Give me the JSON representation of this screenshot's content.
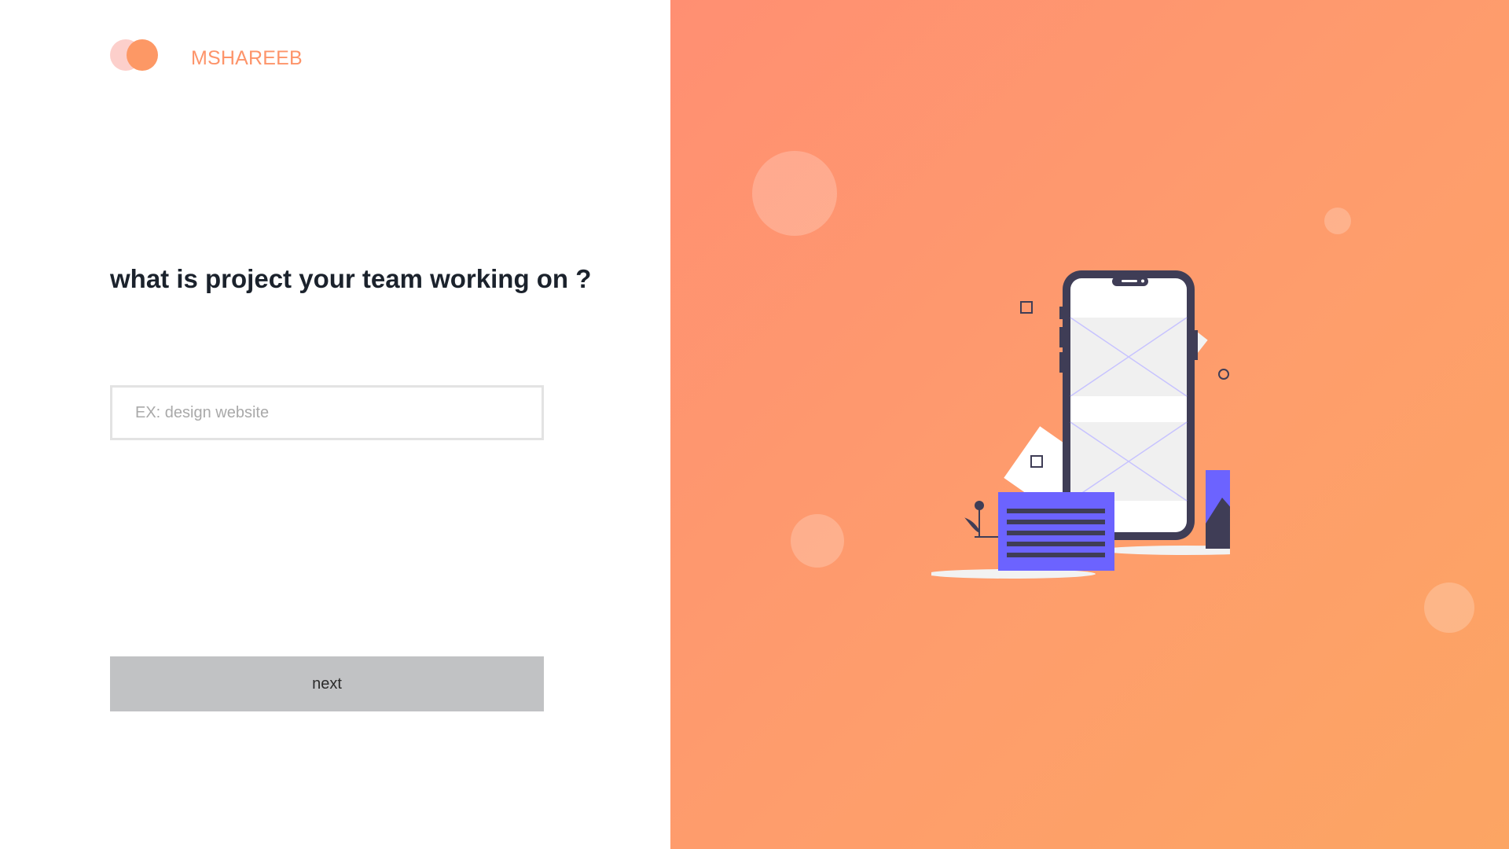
{
  "brand": {
    "name": "MSHAREEB"
  },
  "form": {
    "question": "what is project your team working on ?",
    "input_placeholder": "EX: design website",
    "input_value": "",
    "next_label": "next"
  },
  "colors": {
    "brand_text": "#fd946a",
    "logo_back": "#fccfcb",
    "logo_front": "#fd9865",
    "heading": "#1b222c",
    "button_bg": "#c1c2c4",
    "gradient_start": "#ff8f72",
    "gradient_end": "#fca563",
    "illustration_accent": "#6c63ff",
    "illustration_dark": "#3f3d56"
  },
  "icons": {
    "logo": "overlapping-circles-logo",
    "illustration": "mobile-wireframe-person-illustration"
  }
}
